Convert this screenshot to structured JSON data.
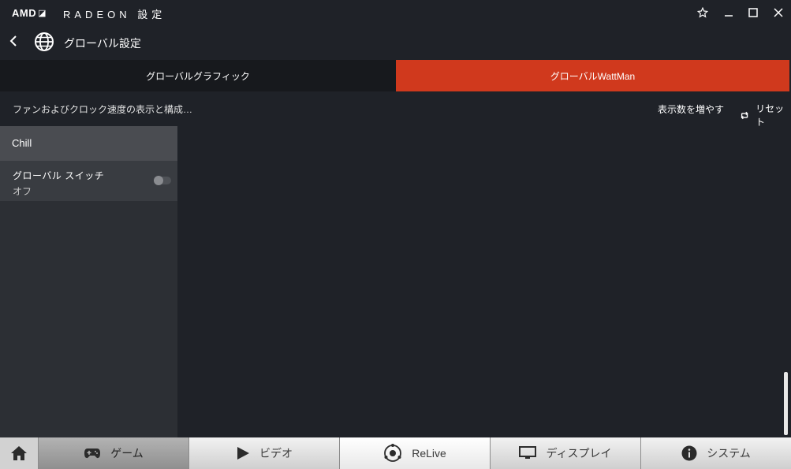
{
  "app": {
    "brand": "AMD",
    "title": "RADEON 設定"
  },
  "header": {
    "title": "グローバル設定"
  },
  "tabs": [
    {
      "label": "グローバルグラフィック"
    },
    {
      "label": "グローバルWattMan"
    }
  ],
  "subbar": {
    "description": "ファンおよびクロック速度の表示と構成…",
    "show_more": "表示数を増やす",
    "reset": "リセット"
  },
  "panel": {
    "section": "Chill",
    "switch_label": "グローバル スイッチ",
    "switch_value": "オフ"
  },
  "nav": [
    {
      "label": "ゲーム",
      "icon": "gamepad-icon"
    },
    {
      "label": "ビデオ",
      "icon": "play-icon"
    },
    {
      "label": "ReLive",
      "icon": "relive-icon"
    },
    {
      "label": "ディスプレイ",
      "icon": "monitor-icon"
    },
    {
      "label": "システム",
      "icon": "info-icon"
    }
  ],
  "colors": {
    "accent": "#d0391d",
    "background": "#1f2228"
  }
}
